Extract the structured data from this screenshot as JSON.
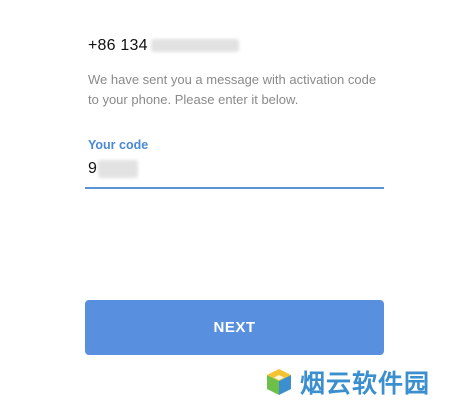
{
  "phone": {
    "prefix": "+86 134"
  },
  "message": "We have sent you a message with activation code to your phone. Please enter it below.",
  "code": {
    "label": "Your code",
    "value": "9"
  },
  "next_button": {
    "label": "NEXT"
  },
  "watermark": {
    "text": "烟云软件园"
  },
  "colors": {
    "accent": "#5890df",
    "label": "#4a8ad4",
    "muted_text": "#8a8a8a"
  }
}
